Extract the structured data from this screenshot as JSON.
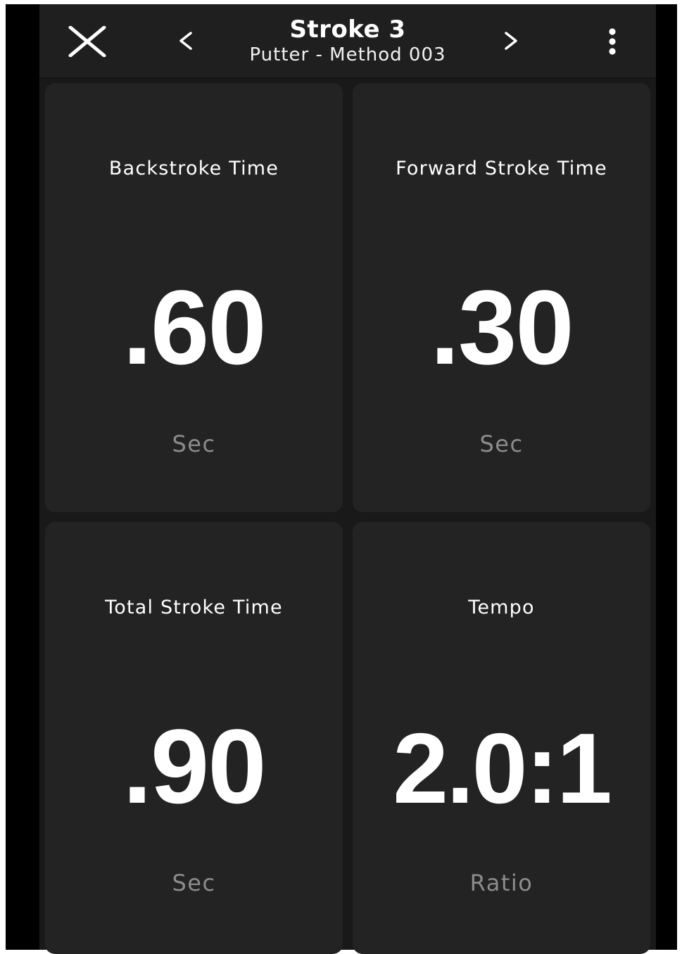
{
  "header": {
    "title": "Stroke 3",
    "subtitle": "Putter - Method 003",
    "close_icon": "close-icon",
    "prev_icon": "chevron-left-icon",
    "next_icon": "chevron-right-icon",
    "more_icon": "more-vertical-icon"
  },
  "metrics": [
    {
      "label": "Backstroke Time",
      "value": ".60",
      "unit": "Sec"
    },
    {
      "label": "Forward Stroke Time",
      "value": ".30",
      "unit": "Sec"
    },
    {
      "label": "Total Stroke Time",
      "value": ".90",
      "unit": "Sec"
    },
    {
      "label": "Tempo",
      "value": "2.0:1",
      "unit": "Ratio"
    }
  ],
  "colors": {
    "background": "#191919",
    "card": "#232323",
    "text": "#ffffff",
    "unit_text": "#8c8c8c"
  }
}
